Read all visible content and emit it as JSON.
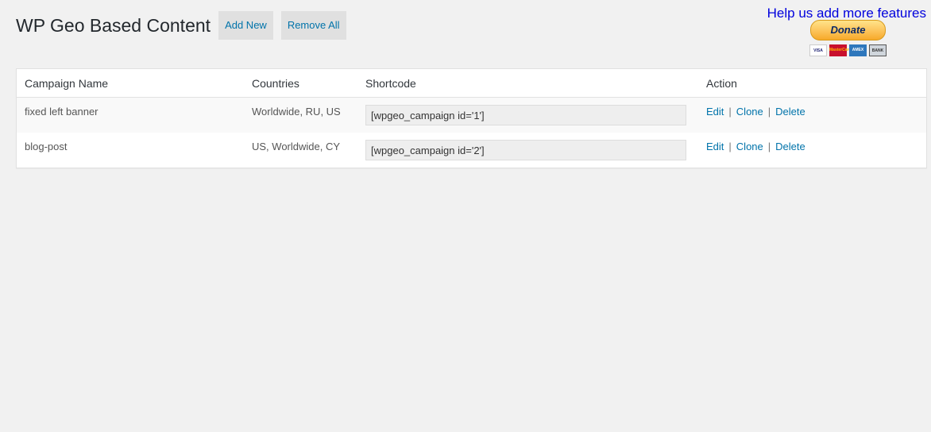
{
  "header": {
    "title": "WP Geo Based Content",
    "add_new_label": "Add New",
    "remove_all_label": "Remove All"
  },
  "donate": {
    "heading": "Help us add more features",
    "button_label": "Donate",
    "cards": [
      "VISA",
      "MasterCard",
      "AMEX",
      "BANK"
    ]
  },
  "table": {
    "columns": [
      "Campaign Name",
      "Countries",
      "Shortcode",
      "Action"
    ],
    "rows": [
      {
        "name": "fixed left banner",
        "countries": "Worldwide, RU, US",
        "shortcode": "[wpgeo_campaign id='1']",
        "actions": [
          "Edit",
          "Clone",
          "Delete"
        ]
      },
      {
        "name": "blog-post",
        "countries": "US, Worldwide, CY",
        "shortcode": "[wpgeo_campaign id='2']",
        "actions": [
          "Edit",
          "Clone",
          "Delete"
        ]
      }
    ],
    "separator": "|"
  },
  "colors": {
    "link": "#0073aa",
    "donate_heading": "#0000dd",
    "background": "#f1f1f1"
  }
}
